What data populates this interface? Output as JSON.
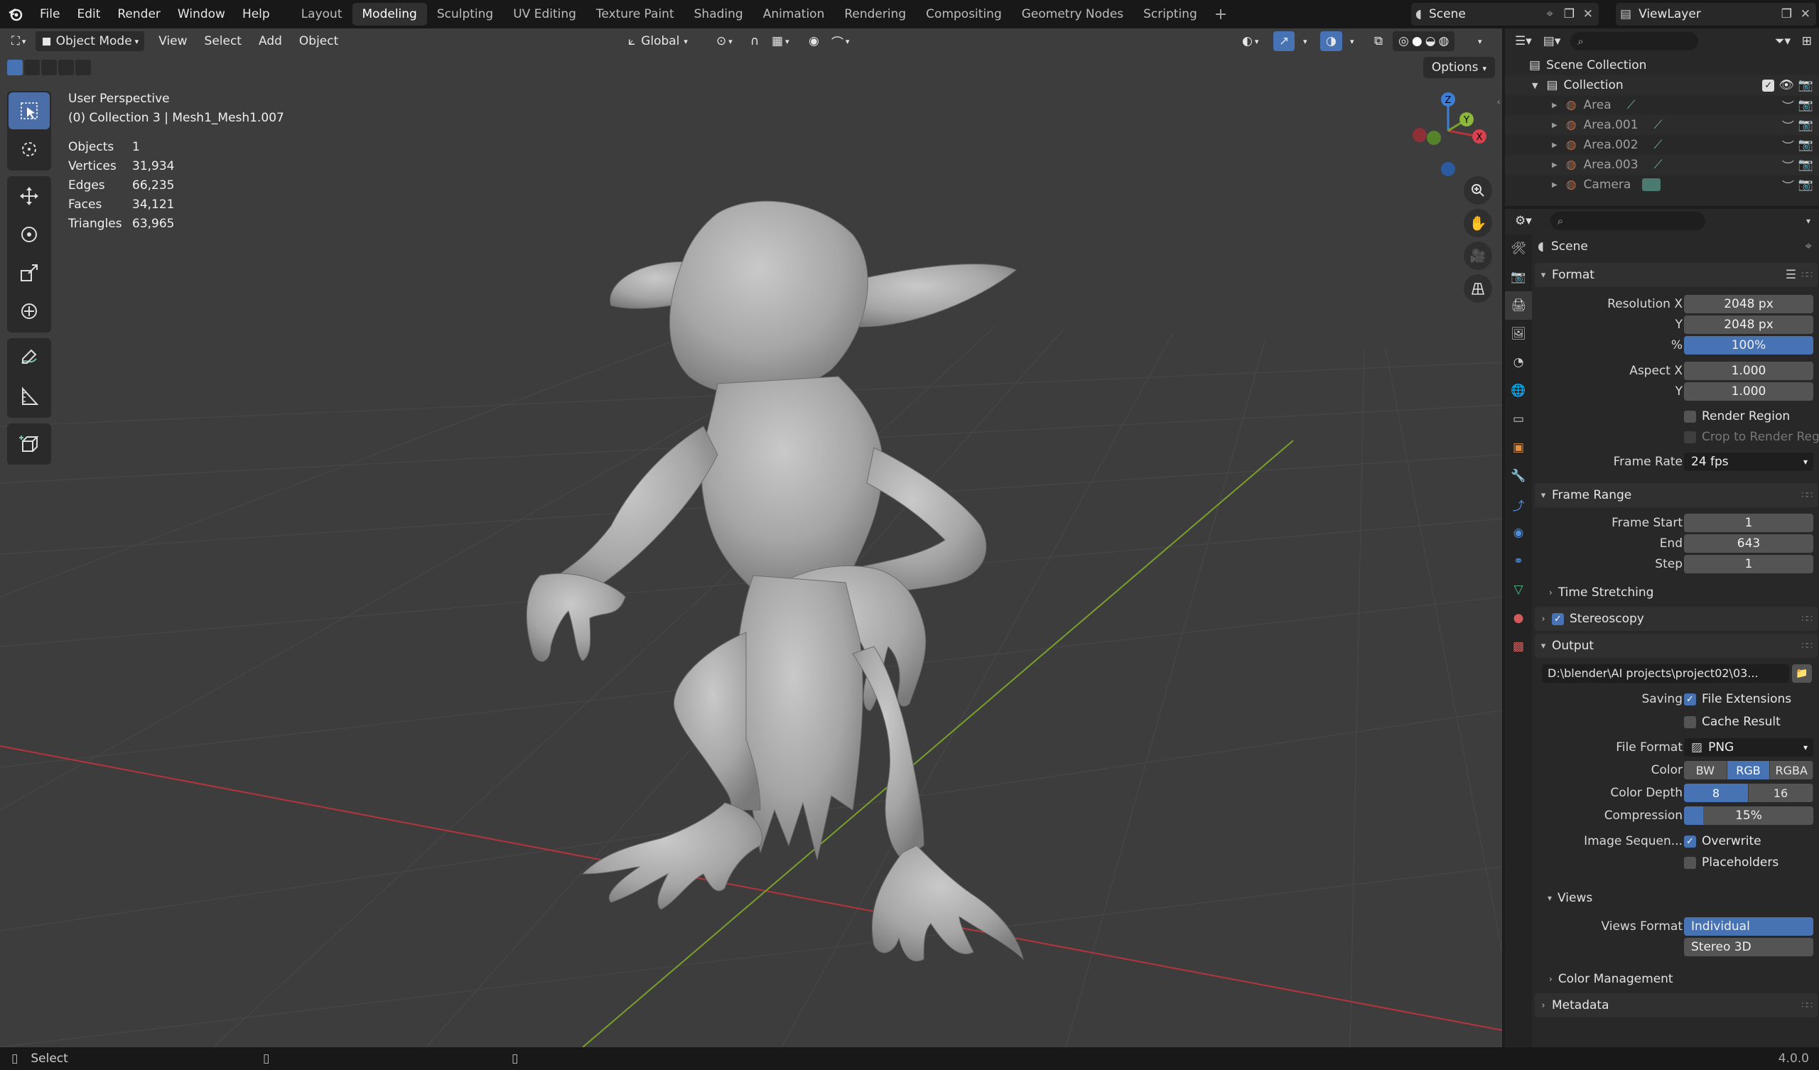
{
  "topbar": {
    "menus": [
      "File",
      "Edit",
      "Render",
      "Window",
      "Help"
    ],
    "workspaces": [
      "Layout",
      "Modeling",
      "Sculpting",
      "UV Editing",
      "Texture Paint",
      "Shading",
      "Animation",
      "Rendering",
      "Compositing",
      "Geometry Nodes",
      "Scripting"
    ],
    "active_workspace": "Modeling",
    "scene_name": "Scene",
    "view_layer": "ViewLayer"
  },
  "viewport": {
    "mode": "Object Mode",
    "menus": [
      "View",
      "Select",
      "Add",
      "Object"
    ],
    "transform_orientation": "Global",
    "options_label": "Options",
    "view_name": "User Perspective",
    "collection_info": "(0) Collection 3 | Mesh1_Mesh1.007",
    "stats": [
      {
        "label": "Objects",
        "value": "1"
      },
      {
        "label": "Vertices",
        "value": "31,934"
      },
      {
        "label": "Edges",
        "value": "66,235"
      },
      {
        "label": "Faces",
        "value": "34,121"
      },
      {
        "label": "Triangles",
        "value": "63,965"
      }
    ],
    "gizmo": {
      "x": "X",
      "y": "Y",
      "z": "Z"
    }
  },
  "outliner": {
    "root": "Scene Collection",
    "collection": "Collection",
    "items": [
      "Area",
      "Area.001",
      "Area.002",
      "Area.003",
      "Camera"
    ]
  },
  "properties": {
    "context": "Scene",
    "format": {
      "title": "Format",
      "resolution_x_label": "Resolution X",
      "resolution_x": "2048 px",
      "resolution_y_label": "Y",
      "resolution_y": "2048 px",
      "percent_label": "%",
      "percent": "100%",
      "aspect_x_label": "Aspect X",
      "aspect_x": "1.000",
      "aspect_y_label": "Y",
      "aspect_y": "1.000",
      "render_region": "Render Region",
      "crop": "Crop to Render Reg...",
      "frame_rate_label": "Frame Rate",
      "frame_rate": "24 fps"
    },
    "frame_range": {
      "title": "Frame Range",
      "start_label": "Frame Start",
      "start": "1",
      "end_label": "End",
      "end": "643",
      "step_label": "Step",
      "step": "1",
      "time_stretching": "Time Stretching"
    },
    "stereoscopy": "Stereoscopy",
    "output": {
      "title": "Output",
      "path": "D:\\blender\\AI projects\\project02\\03...",
      "saving_label": "Saving",
      "file_extensions": "File Extensions",
      "cache_result": "Cache Result",
      "file_format_label": "File Format",
      "file_format": "PNG",
      "color_label": "Color",
      "color_options": [
        "BW",
        "RGB",
        "RGBA"
      ],
      "color_selected": "RGB",
      "color_depth_label": "Color Depth",
      "color_depth_options": [
        "8",
        "16"
      ],
      "color_depth_selected": "8",
      "compression_label": "Compression",
      "compression": "15%",
      "compression_fraction": 0.15,
      "image_seq_label": "Image Sequen...",
      "overwrite": "Overwrite",
      "placeholders": "Placeholders",
      "views_title": "Views",
      "views_format_label": "Views Format",
      "views_options": [
        "Individual",
        "Stereo 3D"
      ],
      "views_selected": "Individual"
    },
    "color_management": "Color Management",
    "metadata": "Metadata"
  },
  "statusbar": {
    "select_label": "Select",
    "version": "4.0.0"
  },
  "colors": {
    "accent": "#4772b3",
    "viewport_bg": "#3d3d3d",
    "x_axis": "#b5343d",
    "y_axis": "#7aa02c",
    "z_axis": "#3d7fd6"
  }
}
